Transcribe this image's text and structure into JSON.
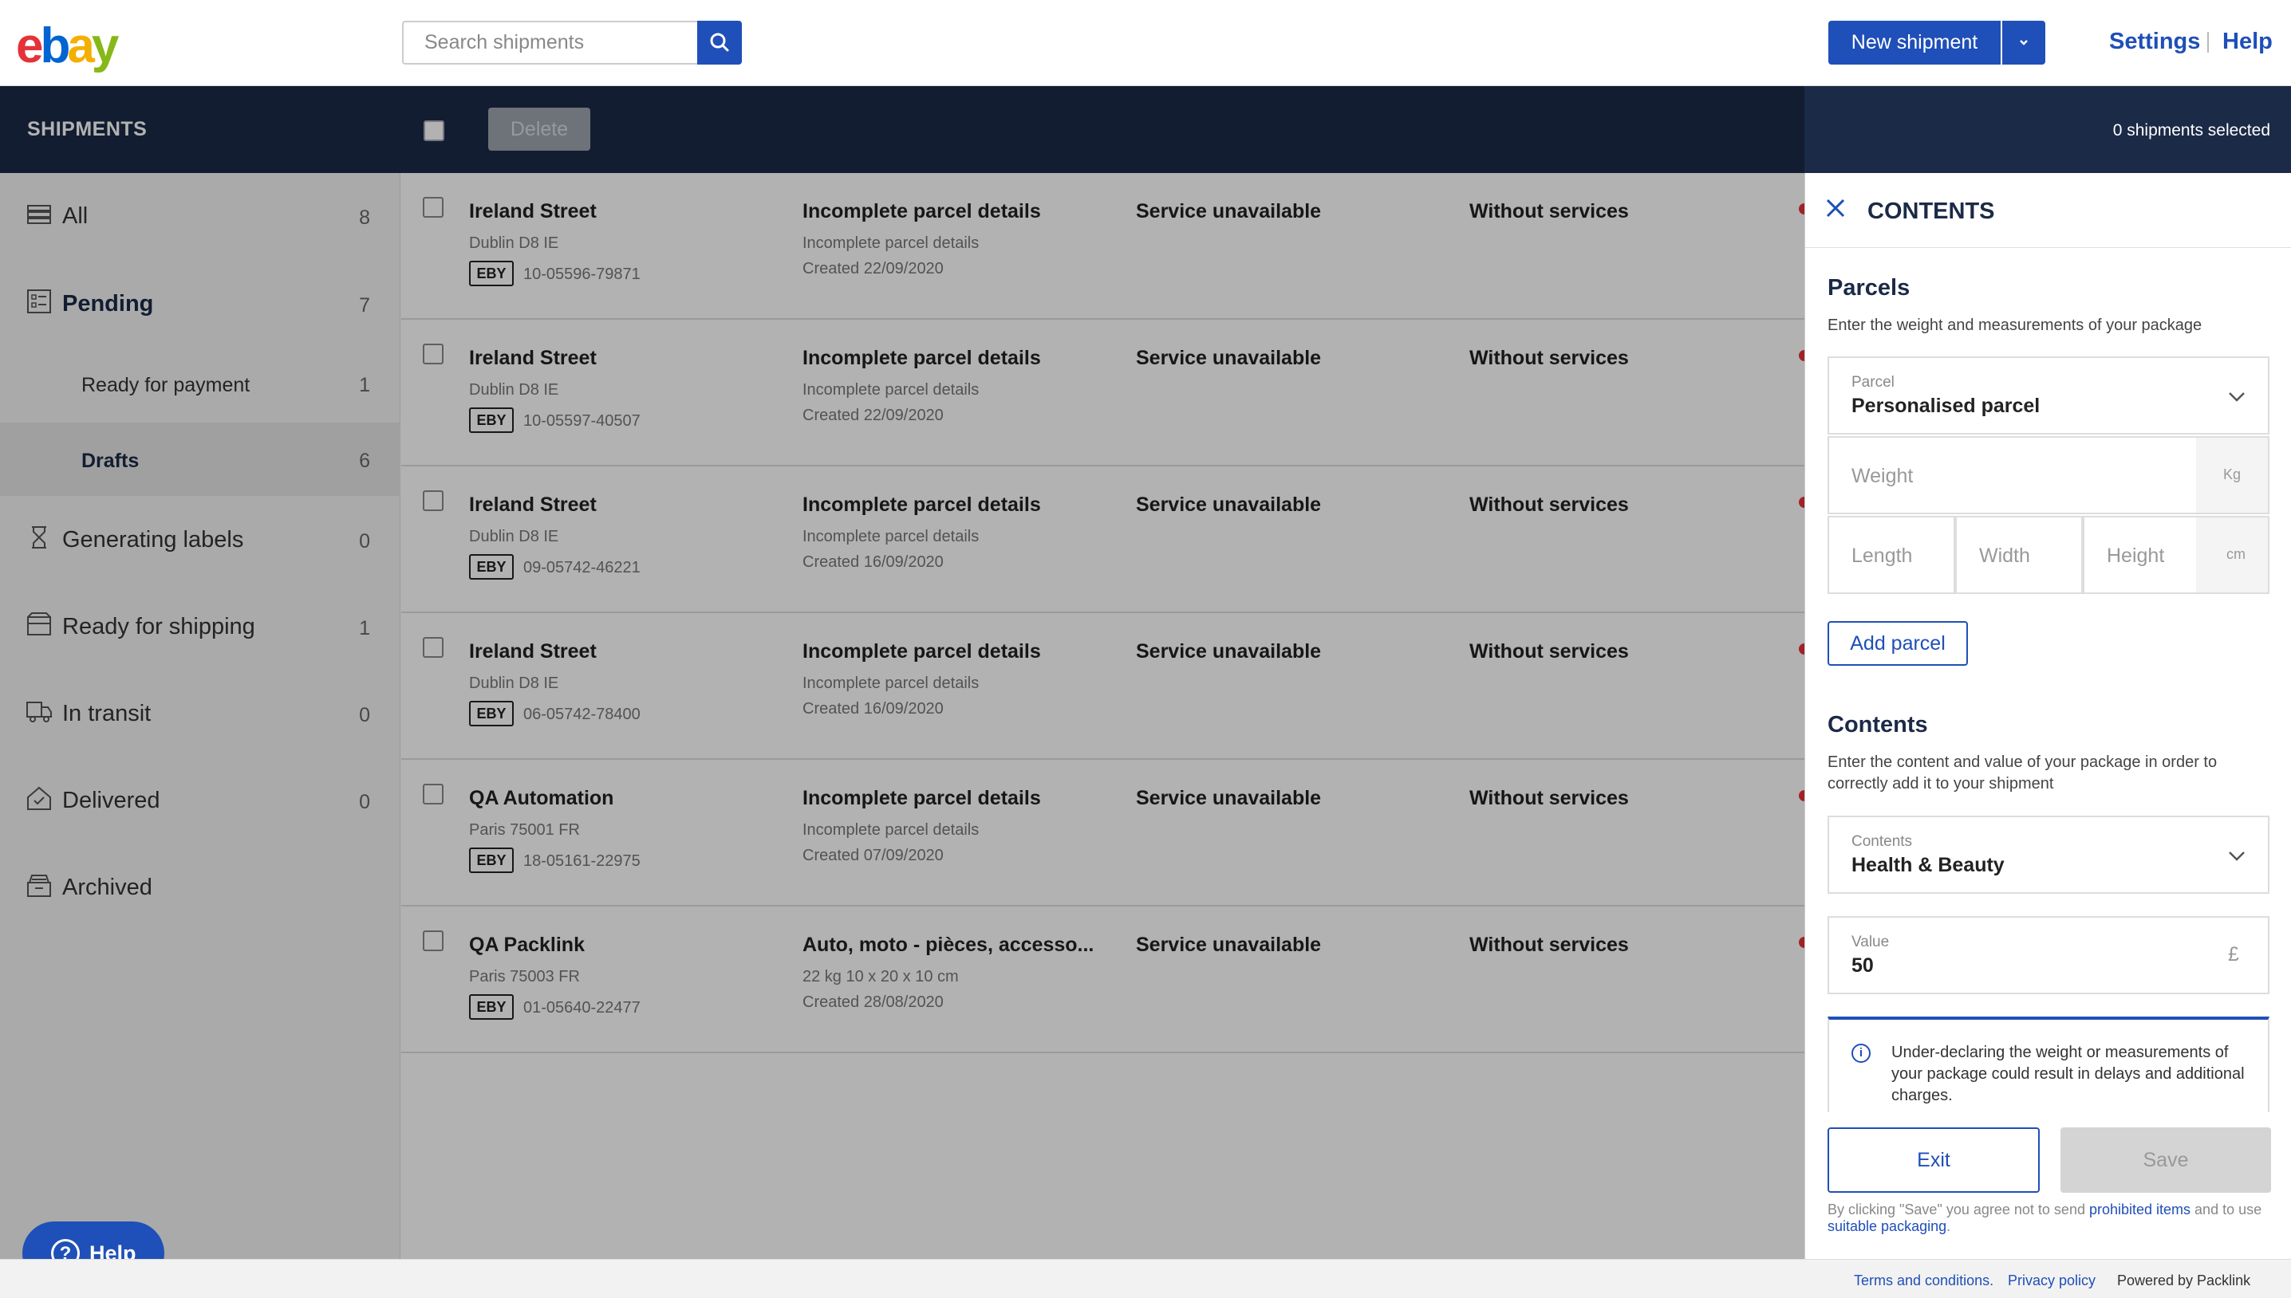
{
  "header": {
    "search_placeholder": "Search shipments",
    "new_shipment": "New shipment",
    "settings": "Settings",
    "help": "Help"
  },
  "toolbar": {
    "title": "SHIPMENTS",
    "delete": "Delete",
    "selected": "0 shipments selected"
  },
  "sidebar": {
    "items": [
      {
        "label": "All",
        "count": "8",
        "icon": "stack-icon"
      },
      {
        "label": "Pending",
        "count": "7",
        "icon": "checklist-icon"
      },
      {
        "label": "Ready for payment",
        "count": "1"
      },
      {
        "label": "Drafts",
        "count": "6"
      },
      {
        "label": "Generating labels",
        "count": "0",
        "icon": "hourglass-icon"
      },
      {
        "label": "Ready for shipping",
        "count": "1",
        "icon": "box-icon"
      },
      {
        "label": "In transit",
        "count": "0",
        "icon": "truck-icon"
      },
      {
        "label": "Delivered",
        "count": "0",
        "icon": "home-icon"
      },
      {
        "label": "Archived",
        "count": "",
        "icon": "archive-icon"
      }
    ],
    "help_button": "Help"
  },
  "shipments": [
    {
      "name": "Ireland Street",
      "address": "Dublin D8 IE",
      "tag": "EBY",
      "ref": "10-05596-79871",
      "status": "Incomplete parcel details",
      "sub1": "Incomplete parcel details",
      "sub2": "Created 22/09/2020",
      "service": "Service unavailable",
      "without": "Without services"
    },
    {
      "name": "Ireland Street",
      "address": "Dublin D8 IE",
      "tag": "EBY",
      "ref": "10-05597-40507",
      "status": "Incomplete parcel details",
      "sub1": "Incomplete parcel details",
      "sub2": "Created 22/09/2020",
      "service": "Service unavailable",
      "without": "Without services"
    },
    {
      "name": "Ireland Street",
      "address": "Dublin D8 IE",
      "tag": "EBY",
      "ref": "09-05742-46221",
      "status": "Incomplete parcel details",
      "sub1": "Incomplete parcel details",
      "sub2": "Created 16/09/2020",
      "service": "Service unavailable",
      "without": "Without services"
    },
    {
      "name": "Ireland Street",
      "address": "Dublin D8 IE",
      "tag": "EBY",
      "ref": "06-05742-78400",
      "status": "Incomplete parcel details",
      "sub1": "Incomplete parcel details",
      "sub2": "Created 16/09/2020",
      "service": "Service unavailable",
      "without": "Without services"
    },
    {
      "name": "QA Automation",
      "address": "Paris 75001 FR",
      "tag": "EBY",
      "ref": "18-05161-22975",
      "status": "Incomplete parcel details",
      "sub1": "Incomplete parcel details",
      "sub2": "Created 07/09/2020",
      "service": "Service unavailable",
      "without": "Without services"
    },
    {
      "name": "QA Packlink",
      "address": "Paris 75003 FR",
      "tag": "EBY",
      "ref": "01-05640-22477",
      "status": "Auto, moto - pièces, accesso...",
      "sub1": "22 kg 10 x 20 x 10 cm",
      "sub2": "Created 28/08/2020",
      "service": "Service unavailable",
      "without": "Without services"
    }
  ],
  "panel": {
    "title": "CONTENTS",
    "parcels_heading": "Parcels",
    "parcels_desc": "Enter the weight and measurements of your package",
    "parcel_label": "Parcel",
    "parcel_value": "Personalised parcel",
    "weight_ph": "Weight",
    "weight_unit": "Kg",
    "length_ph": "Length",
    "width_ph": "Width",
    "height_ph": "Height",
    "dim_unit": "cm",
    "add_parcel": "Add parcel",
    "contents_heading": "Contents",
    "contents_desc": "Enter the content and value of your package in order to correctly add it to your shipment",
    "contents_label": "Contents",
    "contents_value": "Health & Beauty",
    "value_label": "Value",
    "value_value": "50",
    "value_currency": "£",
    "warning": "Under-declaring the weight or measurements of your package could result in delays and additional charges.",
    "exit": "Exit",
    "save": "Save",
    "disclaimer_1": "By clicking \"Save\" you agree not to send ",
    "disclaimer_link1": "prohibited items",
    "disclaimer_2": " and to use ",
    "disclaimer_link2": "suitable packaging",
    "disclaimer_3": "."
  },
  "footer": {
    "terms": "Terms and conditions.",
    "privacy": "Privacy policy",
    "powered": "Powered by Packlink"
  },
  "colors": {
    "brand_blue": "#1f4fb8",
    "dark_bar": "#1b2a47",
    "ebay_red": "#e53238",
    "ebay_blue": "#0064d2",
    "ebay_yellow": "#f5af02",
    "ebay_green": "#86b817"
  }
}
